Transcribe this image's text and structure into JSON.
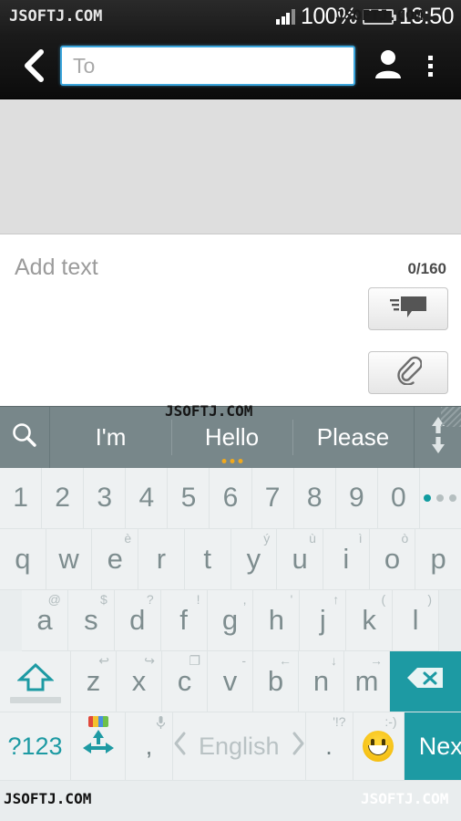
{
  "status_bar": {
    "carrier_watermark": "JSOFTJ.COM",
    "battery_percent": "100%",
    "time": "13:50",
    "battery_color": "#62cc23",
    "signal_icon": "signal-bars-icon",
    "battery_icon": "battery-full-icon"
  },
  "app_bar": {
    "back_icon": "chevron-left-icon",
    "recipient_placeholder": "To",
    "recipient_value": "",
    "contacts_icon": "person-icon",
    "overflow_icon": "overflow-menu-icon",
    "field_border_color": "#3ca6dd"
  },
  "compose": {
    "body_placeholder": "Add text",
    "char_counter": "0/160",
    "quick_text_icon": "speech-bubble-icon",
    "attach_icon": "paperclip-icon"
  },
  "keyboard": {
    "accent_color": "#1d9aa3",
    "suggestion_bar": {
      "search_icon": "search-icon",
      "suggestions": [
        "I'm",
        "Hello",
        "Please"
      ],
      "active_index": 1,
      "expand_icon": "up-down-arrows-icon",
      "dots": 3
    },
    "number_row": [
      "1",
      "2",
      "3",
      "4",
      "5",
      "6",
      "7",
      "8",
      "9",
      "0"
    ],
    "pager": {
      "icon": "page-dots-icon",
      "total": 3,
      "active": 1
    },
    "row_qwerty": [
      {
        "label": "q",
        "hint": ""
      },
      {
        "label": "w",
        "hint": ""
      },
      {
        "label": "e",
        "hint": "è"
      },
      {
        "label": "r",
        "hint": ""
      },
      {
        "label": "t",
        "hint": ""
      },
      {
        "label": "y",
        "hint": "ý"
      },
      {
        "label": "u",
        "hint": "ù"
      },
      {
        "label": "i",
        "hint": "ì"
      },
      {
        "label": "o",
        "hint": "ò"
      },
      {
        "label": "p",
        "hint": ""
      }
    ],
    "row_asdf": [
      {
        "label": "a",
        "hint": "@"
      },
      {
        "label": "s",
        "hint": "$"
      },
      {
        "label": "d",
        "hint": "?"
      },
      {
        "label": "f",
        "hint": "!"
      },
      {
        "label": "g",
        "hint": ","
      },
      {
        "label": "h",
        "hint": "'"
      },
      {
        "label": "j",
        "hint": "↑"
      },
      {
        "label": "k",
        "hint": "("
      },
      {
        "label": "l",
        "hint": ")"
      }
    ],
    "row_zxcv": [
      {
        "label": "z",
        "hint": "↩"
      },
      {
        "label": "x",
        "hint": "↪"
      },
      {
        "label": "c",
        "hint": "❐"
      },
      {
        "label": "v",
        "hint": "-"
      },
      {
        "label": "b",
        "hint": "←"
      },
      {
        "label": "n",
        "hint": "↓"
      },
      {
        "label": "m",
        "hint": "→"
      }
    ],
    "shift": {
      "icon": "shift-up-arrow-icon"
    },
    "backspace": {
      "icon": "backspace-icon"
    },
    "bottom_row": {
      "symbols_label": "?123",
      "cursor_icon": "four-way-arrows-icon",
      "language_chip_icon": "language-switch-icon",
      "comma_label": ",",
      "comma_hint_icon": "microphone-icon",
      "space_prev_icon": "chevron-left-icon",
      "space_label": "English",
      "space_next_icon": "chevron-right-icon",
      "period_label": ".",
      "period_hint": "'!?",
      "emoji_icon": "smiley-face-icon",
      "emoji_hint": ":-)",
      "next_label": "Next"
    }
  },
  "watermarks": {
    "text": "JSOFTJ.COM"
  }
}
